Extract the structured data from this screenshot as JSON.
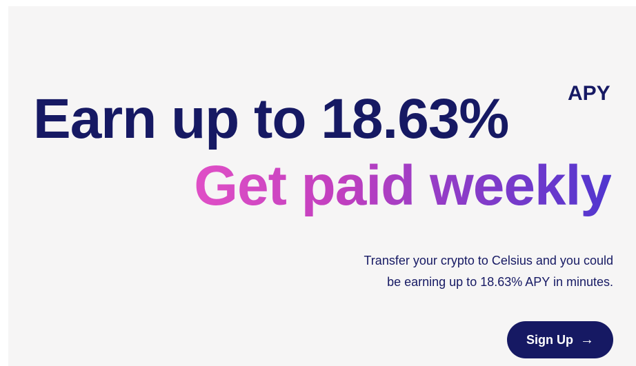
{
  "hero": {
    "headline_line1": "Earn up to 18.63%",
    "apy_superscript": "APY",
    "headline_line2": "Get paid weekly",
    "description_line1": "Transfer your crypto to Celsius and you could",
    "description_line2": "be earning up to 18.63% APY in minutes."
  },
  "cta": {
    "signup_label": "Sign Up",
    "arrow_icon": "→"
  },
  "colors": {
    "background": "#f6f5f5",
    "navy": "#161963",
    "gradient_start": "#e04fc6",
    "gradient_end": "#5036cf"
  }
}
